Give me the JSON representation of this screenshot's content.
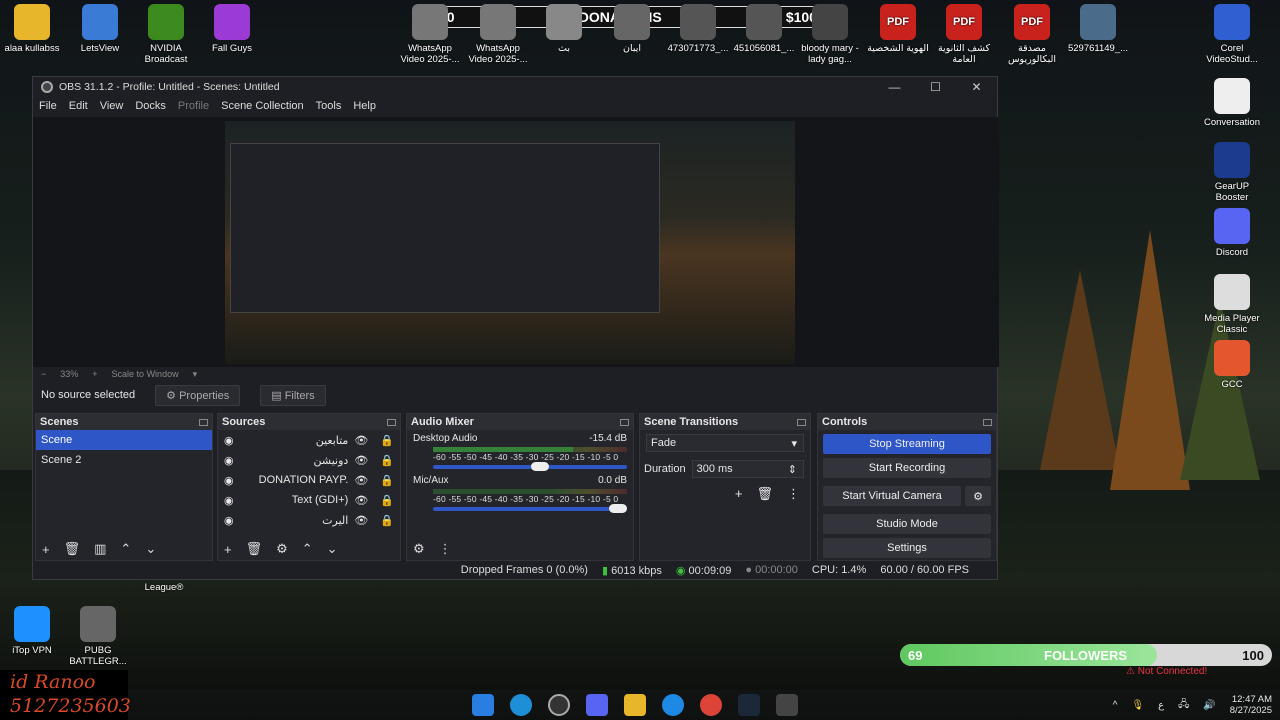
{
  "donations": {
    "left_amount": "$0",
    "title": "DONATIONS",
    "right_amount": "$100"
  },
  "desktop_icons_top": [
    {
      "label": "alaa kullabss",
      "color": "#e8b62a"
    },
    {
      "label": "LetsView",
      "color": "#3a7bd5"
    },
    {
      "label": "NVIDIA Broadcast",
      "color": "#3d8b1f"
    },
    {
      "label": "Fall Guys",
      "color": "#9b3ad5"
    },
    {
      "label": "WhatsApp Video 2025-...",
      "color": "#777"
    },
    {
      "label": "WhatsApp Video 2025-...",
      "color": "#777"
    },
    {
      "label": "بث",
      "color": "#888"
    },
    {
      "label": "ايبان",
      "color": "#666"
    },
    {
      "label": "473071773_...",
      "color": "#555"
    },
    {
      "label": "451056081_...",
      "color": "#555"
    },
    {
      "label": "bloody mary - lady gag...",
      "color": "#444"
    },
    {
      "label": "الهوية الشخصية",
      "color": "pdf"
    },
    {
      "label": "كشف الثانوية العامة",
      "color": "pdf"
    },
    {
      "label": "مصدقة البكالوريوس",
      "color": "pdf"
    },
    {
      "label": "529761149_...",
      "color": "#4a6b8a"
    },
    {
      "label": "Corel VideoStud...",
      "color": "#2f5fd0"
    }
  ],
  "desktop_icons_right": [
    {
      "label": "Conversation",
      "color": "#eee"
    },
    {
      "label": "GearUP Booster",
      "color": "#1c3b8f"
    },
    {
      "label": "Discord",
      "color": "#5865f2"
    },
    {
      "label": "Media Player Classic",
      "color": "#ddd"
    },
    {
      "label": "GCC",
      "color": "#e4572e"
    }
  ],
  "desktop_icons_bottom": [
    {
      "label": "iTop VPN",
      "color": "#1e90ff"
    },
    {
      "label": "PUBG BATTLEGR...",
      "color": "#666"
    }
  ],
  "desktop_misc": {
    "league_label": "League®"
  },
  "obs": {
    "title": "OBS 31.1.2 - Profile: Untitled - Scenes: Untitled",
    "menu": [
      "File",
      "Edit",
      "View",
      "Docks",
      "Profile",
      "Scene Collection",
      "Tools",
      "Help"
    ],
    "zoom": "33%",
    "scale_mode": "Scale to Window",
    "no_source": "No source selected",
    "properties_btn": "Properties",
    "filters_btn": "Filters",
    "scenes": {
      "title": "Scenes",
      "items": [
        "Scene",
        "Scene 2"
      ]
    },
    "sources": {
      "title": "Sources",
      "items": [
        "متابعين",
        "دونيشن",
        "DONATION PAYP.",
        "Text (GDI+)",
        "اليرت"
      ]
    },
    "mixer": {
      "title": "Audio Mixer",
      "channels": [
        {
          "name": "Desktop Audio",
          "db": "-15.4 dB",
          "level": 0.72,
          "volume": 0.6
        },
        {
          "name": "Mic/Aux",
          "db": "0.0 dB",
          "level": 0.0,
          "volume": 1.0
        }
      ],
      "ticks": "-60 -55 -50 -45 -40 -35 -30 -25 -20 -15 -10 -5 0"
    },
    "transitions": {
      "title": "Scene Transitions",
      "type": "Fade",
      "duration_label": "Duration",
      "duration": "300 ms"
    },
    "controls": {
      "title": "Controls",
      "buttons": [
        "Stop Streaming",
        "Start Recording",
        "Start Virtual Camera",
        "Studio Mode",
        "Settings"
      ]
    },
    "status": {
      "dropped": "Dropped Frames 0 (0.0%)",
      "bitrate": "6013 kbps",
      "stream_time": "00:09:09",
      "rec_time": "00:00:00",
      "cpu": "CPU: 1.4%",
      "fps": "60.00 / 60.00 FPS"
    }
  },
  "followers": {
    "current": "69",
    "label": "FOLLOWERS",
    "goal": "100",
    "progress": 0.69,
    "status": "Not Connected!"
  },
  "overlay_id": {
    "line1": "id Ranoo",
    "line2": "5127235603"
  },
  "taskbar": {
    "time": "12:47 AM",
    "date": "8/27/2025",
    "lang": "ع"
  }
}
